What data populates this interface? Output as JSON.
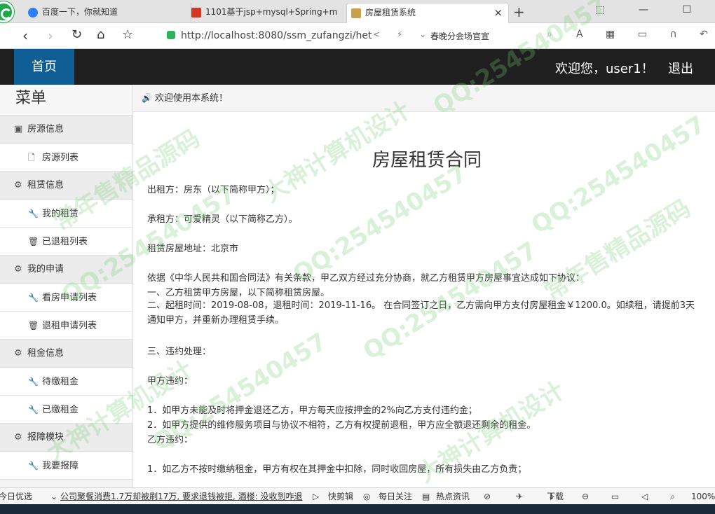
{
  "browser": {
    "tabs": [
      {
        "title": "百度一下，你就知道"
      },
      {
        "title": "1101基于jsp+mysql+Spring+m"
      },
      {
        "title": "房屋租赁系统"
      }
    ],
    "close_glyph": "×",
    "new_tab_glyph": "+",
    "window_controls": "⬚ — ☐",
    "url": "http://localhost:8080/ssm_zufangzi/het",
    "hot_word": "春晚分会场官宣",
    "zoom": "100%"
  },
  "header": {
    "home": "首页",
    "welcome": "欢迎您，user1！",
    "logout": "退出"
  },
  "sidebar": {
    "title": "菜单",
    "sections": [
      {
        "label": "房源信息",
        "icon": "list-icon",
        "items": [
          {
            "label": "房源列表",
            "icon": "file-icon"
          }
        ]
      },
      {
        "label": "租赁信息",
        "icon": "gear-icon",
        "items": [
          {
            "label": "我的租赁",
            "icon": "wrench-icon"
          },
          {
            "label": "已退租列表",
            "icon": "trash-icon"
          }
        ]
      },
      {
        "label": "我的申请",
        "icon": "gear-icon",
        "items": [
          {
            "label": "看房申请列表",
            "icon": "wrench-icon"
          },
          {
            "label": "退租申请列表",
            "icon": "trash-icon"
          }
        ]
      },
      {
        "label": "租金信息",
        "icon": "gear-icon",
        "items": [
          {
            "label": "待缴租金",
            "icon": "wrench-icon"
          },
          {
            "label": "已缴租金",
            "icon": "wrench-icon"
          }
        ]
      },
      {
        "label": "报障模块",
        "icon": "gear-icon",
        "items": [
          {
            "label": "我要报障",
            "icon": "wrench-icon"
          }
        ]
      }
    ]
  },
  "notice": "欢迎使用本系统！",
  "contract": {
    "title": "房屋租赁合同",
    "lessor": "出租方：房东（以下简称甲方）；",
    "lessee": "承租方：可爱精灵（以下简称乙方）。",
    "address": "租赁房屋地址：北京市",
    "intro": "依据《中华人民共和国合同法》有关条款，甲乙双方经过充分协商，就乙方租赁甲方房屋事宜达成如下协议：",
    "clause1": "一、乙方租赁甲方房屋，以下简称租赁房屋。",
    "clause2": "二、起租时间：2019-08-08，退租时间：2019-11-16。 在合同签订之日，乙方需向甲方支付房屋租金￥1200.0。如续租，请提前3天通知甲方，并重新办理租赁手续。",
    "clause3": "三、违约处理：",
    "party_a_breach": "甲方违约：",
    "a1": "1．如甲方未能及时将押金退还乙方，甲方每天应按押金的2%向乙方支付违约金；",
    "a2": "2．如甲方提供的维修服务项目与协议不相符，乙方有权提前退租，甲方应全额退还剩余的租金。",
    "party_b_breach": "乙方违约：",
    "b1": "1．如乙方不按时缴纳租金，甲方有权在其押金中扣除，同时收回房屋，所有损失由乙方负责；"
  },
  "watermarks": [
    "QQ:254540457",
    "常年售精品源码",
    "大神计算机设计"
  ],
  "statusbar": {
    "left": "今日优选",
    "news": "公司聚餐消费1.7万却被刷17万, 要求退钱被拒, 酒楼: 没收到咋退",
    "kuaijian": "快剪辑",
    "daily": "每日关注",
    "hot": "热点资讯",
    "download": "下载"
  }
}
